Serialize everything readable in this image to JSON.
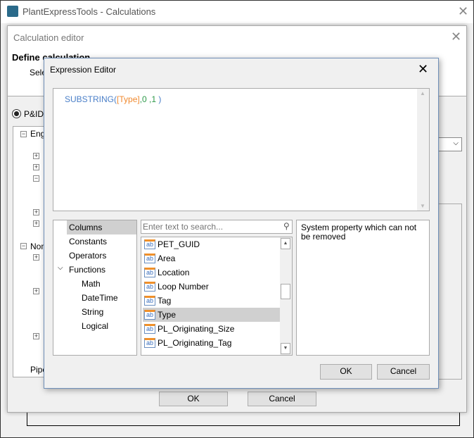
{
  "app": {
    "title": "PlantExpressTools - Calculations"
  },
  "calc_editor": {
    "title": "Calculation editor",
    "heading": "Define calculation",
    "select_label": "Sele",
    "radio_pid": "P&ID",
    "tree": [
      "Engi",
      "Non",
      "Pipe"
    ],
    "ok": "OK",
    "cancel": "Cancel"
  },
  "expr_editor": {
    "title": "Expression Editor",
    "expression": {
      "func": "SUBSTRING(",
      "field": "[Type]",
      "rest1": ",0 ,",
      "num": "1",
      "close": " )"
    },
    "categories": [
      {
        "label": "Columns",
        "selected": true
      },
      {
        "label": "Constants"
      },
      {
        "label": "Operators"
      },
      {
        "label": "Functions",
        "expanded": true
      },
      {
        "label": "Math"
      },
      {
        "label": "DateTime"
      },
      {
        "label": "String"
      },
      {
        "label": "Logical"
      }
    ],
    "search_placeholder": "Enter text to search...",
    "columns": [
      "PET_GUID",
      "Area",
      "Location",
      "Loop Number",
      "Tag",
      "Type",
      "PL_Originating_Size",
      "PL_Originating_Tag"
    ],
    "selected_column": "Type",
    "description": "System property which can not be removed",
    "ok": "OK",
    "cancel": "Cancel"
  },
  "colors": {
    "function": "#4a7fc8",
    "field": "#f08a30",
    "number": "#2e9a4a",
    "dialog_border": "#6f8fb8"
  }
}
